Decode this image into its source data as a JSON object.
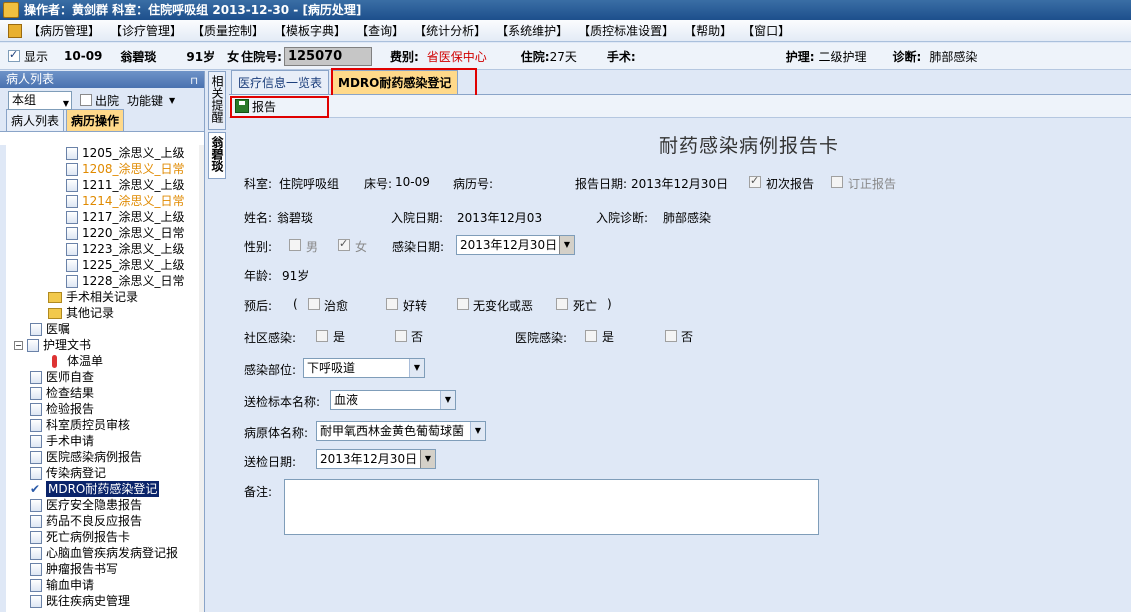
{
  "titlebar": {
    "text": "操作者：黄剑群   科室：住院呼吸组   2013-12-30 - [病历处理]"
  },
  "menu": [
    "【病历管理】",
    "【诊疗管理】",
    "【质量控制】",
    "【模板字典】",
    "【查询】",
    "【统计分析】",
    "【系统维护】",
    "【质控标准设置】",
    "【帮助】",
    "【窗口】"
  ],
  "infobar": {
    "show_label": "显示",
    "bed": "10-09",
    "name": "翁碧琰",
    "age": "91岁",
    "sex": "女",
    "inpatient_label": "住院号:",
    "inpatient_no": "125070",
    "fee_label": "费别:",
    "fee_value": "省医保中心",
    "stay_label": "住院:",
    "stay_value": "27天",
    "surgery_label": "手术:",
    "nursing_label": "护理:",
    "nursing_value": "二级护理",
    "diagnosis_label": "诊断:",
    "diagnosis_value": "肺部感染"
  },
  "leftpanel": {
    "header": "病人列表",
    "group_select": "本组",
    "discharged_label": "出院",
    "function_key": "功能键",
    "tabs": [
      "病人列表",
      "病历操作"
    ]
  },
  "tree": [
    {
      "label": "1205_涂思义_上级",
      "type": "doc",
      "indent": 60,
      "orange": false
    },
    {
      "label": "1208_涂思义_日常",
      "type": "doc",
      "indent": 60,
      "orange": true
    },
    {
      "label": "1211_涂思义_上级",
      "type": "doc",
      "indent": 60,
      "orange": false
    },
    {
      "label": "1214_涂思义_日常",
      "type": "doc",
      "indent": 60,
      "orange": true
    },
    {
      "label": "1217_涂思义_上级",
      "type": "doc",
      "indent": 60,
      "orange": false
    },
    {
      "label": "1220_涂思义_日常",
      "type": "doc",
      "indent": 60,
      "orange": false
    },
    {
      "label": "1223_涂思义_上级",
      "type": "doc",
      "indent": 60,
      "orange": false
    },
    {
      "label": "1225_涂思义_上级",
      "type": "doc",
      "indent": 60,
      "orange": false
    },
    {
      "label": "1228_涂思义_日常",
      "type": "doc",
      "indent": 60,
      "orange": false
    },
    {
      "label": "手术相关记录",
      "type": "folder",
      "indent": 42,
      "orange": false
    },
    {
      "label": "其他记录",
      "type": "folder",
      "indent": 42,
      "orange": false
    },
    {
      "label": "医嘱",
      "type": "doc",
      "indent": 24,
      "orange": false
    },
    {
      "label": "护理文书",
      "type": "expander",
      "indent": 8,
      "orange": false
    },
    {
      "label": "体温单",
      "type": "thermo",
      "indent": 42,
      "orange": false
    },
    {
      "label": "医师自查",
      "type": "doc",
      "indent": 24,
      "orange": false
    },
    {
      "label": "检查结果",
      "type": "doc",
      "indent": 24,
      "orange": false
    },
    {
      "label": "检验报告",
      "type": "doc",
      "indent": 24,
      "orange": false
    },
    {
      "label": "科室质控员审核",
      "type": "doc",
      "indent": 24,
      "orange": false
    },
    {
      "label": "手术申请",
      "type": "doc",
      "indent": 24,
      "orange": false
    },
    {
      "label": "医院感染病例报告",
      "type": "doc",
      "indent": 24,
      "orange": false
    },
    {
      "label": "传染病登记",
      "type": "doc",
      "indent": 24,
      "orange": false
    },
    {
      "label": "MDRO耐药感染登记",
      "type": "check",
      "indent": 24,
      "orange": false,
      "selected": true
    },
    {
      "label": "医疗安全隐患报告",
      "type": "doc",
      "indent": 24,
      "orange": false
    },
    {
      "label": "药品不良反应报告",
      "type": "doc",
      "indent": 24,
      "orange": false
    },
    {
      "label": "死亡病例报告卡",
      "type": "doc",
      "indent": 24,
      "orange": false
    },
    {
      "label": "心脑血管疾病发病登记报",
      "type": "doc",
      "indent": 24,
      "orange": false
    },
    {
      "label": "肿瘤报告书写",
      "type": "doc",
      "indent": 24,
      "orange": false
    },
    {
      "label": "输血申请",
      "type": "doc",
      "indent": 24,
      "orange": false
    },
    {
      "label": "既往疾病史管理",
      "type": "doc",
      "indent": 24,
      "orange": false
    }
  ],
  "vtabs": [
    "相关提醒",
    "翁碧琰"
  ],
  "main": {
    "tabs": [
      "医疗信息一览表",
      "MDRO耐药感染登记"
    ],
    "report_button": "报告"
  },
  "form": {
    "title": "耐药感染病例报告卡",
    "dept_label": "科室:",
    "dept_value": "住院呼吸组",
    "bed_label": "床号:",
    "bed_value": "10-09",
    "record_label": "病历号:",
    "report_date_label": "报告日期:",
    "report_date_value": "2013年12月30日",
    "first_report": "初次报告",
    "revised_report": "订正报告",
    "name_label": "姓名:",
    "name_value": "翁碧琰",
    "admit_date_label": "入院日期:",
    "admit_date_value": "2013年12月03",
    "admit_diag_label": "入院诊断:",
    "admit_diag_value": "肺部感染",
    "sex_label": "性别:",
    "male": "男",
    "female": "女",
    "infect_date_label": "感染日期:",
    "infect_date_value": "2013年12月30日",
    "age_label": "年龄:",
    "age_value": "91岁",
    "prognosis_label": "预后:",
    "paren_open": "(",
    "paren_close": ")",
    "prognosis_options": [
      "治愈",
      "好转",
      "无变化或恶",
      "死亡"
    ],
    "community_label": "社区感染:",
    "yes": "是",
    "no": "否",
    "hospital_label": "医院感染:",
    "site_label": "感染部位:",
    "site_value": "下呼吸道",
    "specimen_label": "送检标本名称:",
    "specimen_value": "血液",
    "pathogen_label": "病原体名称:",
    "pathogen_value": "耐甲氧西林金黄色葡萄球菌",
    "send_date_label": "送检日期:",
    "send_date_value": "2013年12月30日",
    "notes_label": "备注:"
  }
}
